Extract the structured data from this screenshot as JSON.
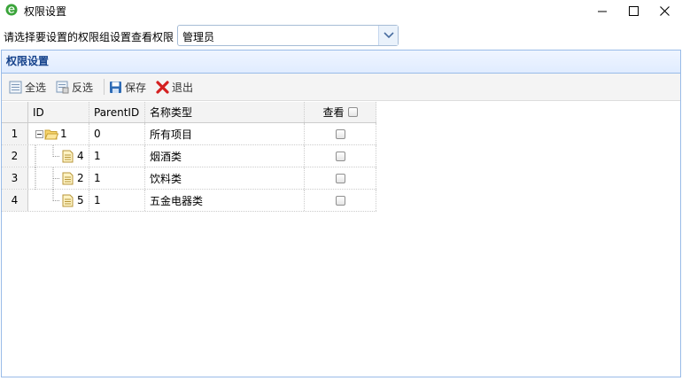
{
  "window": {
    "title": "权限设置",
    "icon": "ie-e-icon",
    "controls": [
      "minimize",
      "maximize",
      "close"
    ]
  },
  "selector": {
    "label": "请选择要设置的权限组设置查看权限",
    "value": "管理员"
  },
  "panel": {
    "title": "权限设置"
  },
  "toolbar": {
    "select_all": "全选",
    "invert": "反选",
    "save": "保存",
    "exit": "退出"
  },
  "grid": {
    "columns": {
      "id": "ID",
      "parent_id": "ParentID",
      "name": "名称类型",
      "view": "查看"
    },
    "rows": [
      {
        "num": "1",
        "id": "1",
        "parent_id": "0",
        "name": "所有项目",
        "type": "folder",
        "checked": false
      },
      {
        "num": "2",
        "id": "4",
        "parent_id": "1",
        "name": "烟酒类",
        "type": "file",
        "checked": false
      },
      {
        "num": "3",
        "id": "2",
        "parent_id": "1",
        "name": "饮料类",
        "type": "file",
        "checked": false
      },
      {
        "num": "4",
        "id": "5",
        "parent_id": "1",
        "name": "五金电器类",
        "type": "file",
        "checked": false
      }
    ]
  },
  "colors": {
    "panel_border": "#99bbe8",
    "panel_title": "#15428b",
    "header_bg": "#e0ecff",
    "exit_red": "#d42020",
    "save_blue": "#2e6bb5"
  }
}
